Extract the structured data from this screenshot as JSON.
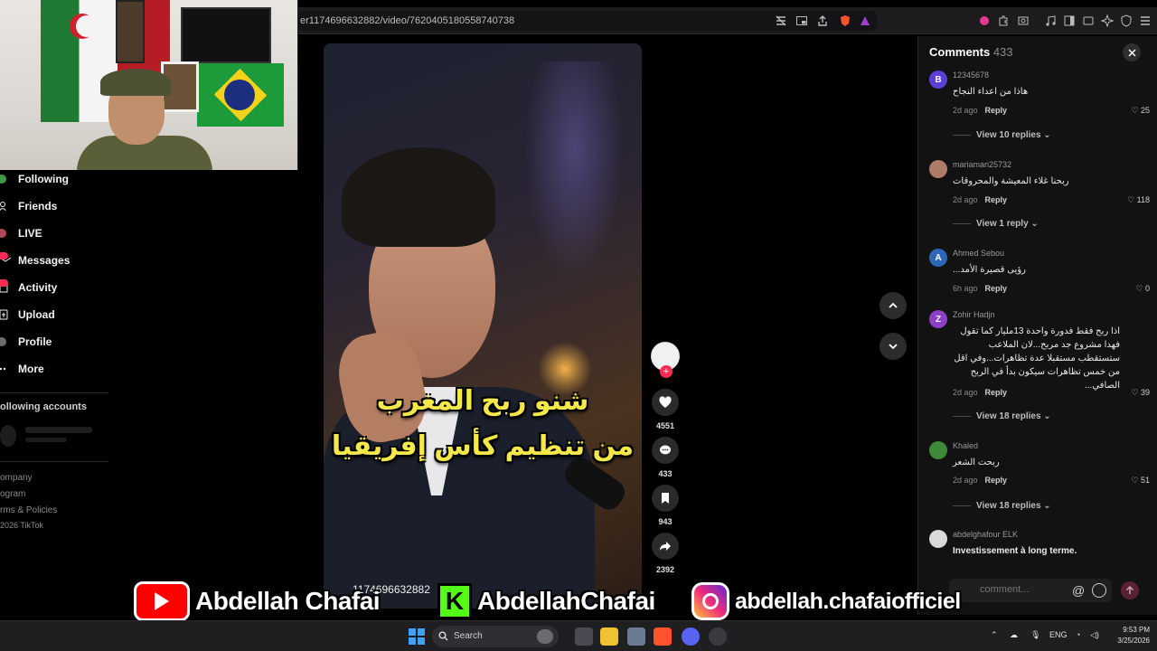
{
  "browser": {
    "url_text": "er1174696632882/video/7620405180558740738"
  },
  "sidebar": {
    "items": [
      {
        "label": "Following",
        "icon": "following-icon"
      },
      {
        "label": "Friends",
        "icon": "friends-icon"
      },
      {
        "label": "LIVE",
        "icon": "live-icon"
      },
      {
        "label": "Messages",
        "icon": "messages-icon"
      },
      {
        "label": "Activity",
        "icon": "activity-icon"
      },
      {
        "label": "Upload",
        "icon": "upload-icon"
      },
      {
        "label": "Profile",
        "icon": "profile-icon"
      },
      {
        "label": "More",
        "icon": "more-icon"
      }
    ],
    "following_accounts_header": "ollowing accounts",
    "footer_links": [
      "ompany",
      "ogram",
      "rms & Policies",
      "2026 TikTok"
    ]
  },
  "video": {
    "caption_line1": "شنو ربح المغرب",
    "caption_line2": "من تنظيم كأس إفريقيا",
    "id_text": "1174696632882"
  },
  "actions": {
    "likes": "4551",
    "comments": "433",
    "saves": "943",
    "shares": "2392"
  },
  "comments": {
    "title": "Comments",
    "count": "433",
    "items": [
      {
        "user": "12345678",
        "avatar_letter": "B",
        "avatar_color": "#5b3fd6",
        "text": "هاذا من اعداء النجاح",
        "time": "2d ago",
        "reply": "Reply",
        "likes": "25",
        "view_replies": "View 10 replies"
      },
      {
        "user": "mariamari25732",
        "avatar_letter": "",
        "avatar_color": "#b07a68",
        "text": "ربحنا غلاء المعيشة والمحروقات",
        "time": "2d ago",
        "reply": "Reply",
        "likes": "118",
        "view_replies": "View 1 reply"
      },
      {
        "user": "Ahmed Sebou",
        "avatar_letter": "A",
        "avatar_color": "#2f67b8",
        "text": "رؤيى قصيرة الأمد...",
        "time": "6h ago",
        "reply": "Reply",
        "likes": "0",
        "view_replies": ""
      },
      {
        "user": "Zohir Hadjn",
        "avatar_letter": "Z",
        "avatar_color": "#8c3fc7",
        "text": "اذا ربح فقط فدورة واحدة 13مليار كما تقول فهدا مشروع جد مربح...لان الملاعب ستستقطب مستقبلا عدة تظاهرات...وفي اقل من خمس تظاهرات سيكون بدأ في الربح الصافي...",
        "time": "2d ago",
        "reply": "Reply",
        "likes": "39",
        "view_replies": "View 18 replies"
      },
      {
        "user": "Khaled",
        "avatar_letter": "",
        "avatar_color": "#3f8a3a",
        "text": "ربحت الشعر",
        "time": "2d ago",
        "reply": "Reply",
        "likes": "51",
        "view_replies": "View 18 replies"
      },
      {
        "user": "abdelghafour ELK",
        "avatar_letter": "",
        "avatar_color": "#d9d9d9",
        "text": "Investissement à long terme.",
        "time": "",
        "reply": "",
        "likes": "",
        "view_replies": ""
      }
    ],
    "input_placeholder": "comment..."
  },
  "banner": {
    "youtube_name": "Abdellah Chafai",
    "kick_name": "AbdellahChafai",
    "kick_letter": "K",
    "instagram_name": "abdellah.chafaiofficiel"
  },
  "taskbar": {
    "search_label": "Search",
    "lang": "ENG",
    "time": "9:53 PM",
    "date": "3/25/2026"
  }
}
